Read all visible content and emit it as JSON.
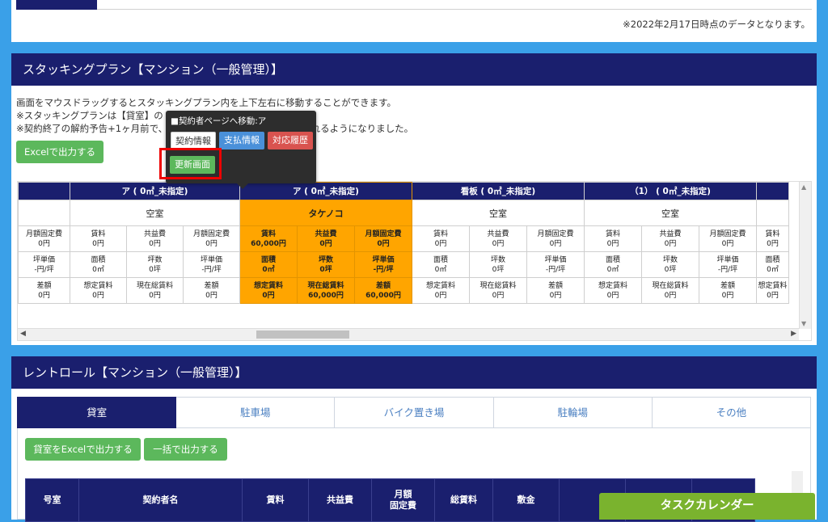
{
  "top": {
    "note": "※2022年2月17日時点のデータとなります。"
  },
  "stacking": {
    "title": "スタッキングプラン【マンション（一般管理）】",
    "desc1": "画面をマウスドラッグするとスタッキングプラン内を上下左右に移動することができます。",
    "desc2": "※スタッキングプランは【貸室】の",
    "desc3": "※契約終了の解約予告+1ヶ月前で、",
    "desc3b": "赤く表示されるようになりました。",
    "excel_button": "Excelで出力する",
    "units": [
      {
        "name": "",
        "tenant": "",
        "labels": [
          [
            "月額固定費",
            "0円"
          ],
          [
            "坪単価",
            "-円/坪"
          ],
          [
            "差額",
            "0円"
          ]
        ]
      },
      {
        "name": "ア ( 0㎡_未指定)",
        "tenant": "空室",
        "cells": [
          [
            [
              "賃料",
              "0円"
            ],
            [
              "共益費",
              "0円"
            ],
            [
              "月額固定費",
              "0円"
            ]
          ],
          [
            [
              "面積",
              "0㎡"
            ],
            [
              "坪数",
              "0坪"
            ],
            [
              "坪単価",
              "-円/坪"
            ]
          ],
          [
            [
              "想定賃料",
              "0円"
            ],
            [
              "現在総賃料",
              "0円"
            ],
            [
              "差額",
              "0円"
            ]
          ]
        ]
      },
      {
        "name": "ア ( 0㎡_未指定)",
        "tenant": "タケノコ",
        "highlight": true,
        "cells": [
          [
            [
              "賃料",
              "60,000円"
            ],
            [
              "共益費",
              "0円"
            ],
            [
              "月額固定費",
              "0円"
            ]
          ],
          [
            [
              "面積",
              "0㎡"
            ],
            [
              "坪数",
              "0坪"
            ],
            [
              "坪単価",
              "-円/坪"
            ]
          ],
          [
            [
              "想定賃料",
              "0円"
            ],
            [
              "現在総賃料",
              "60,000円"
            ],
            [
              "差額",
              "60,000円"
            ]
          ]
        ]
      },
      {
        "name": "看板 ( 0㎡_未指定)",
        "tenant": "空室",
        "cells": [
          [
            [
              "賃料",
              "0円"
            ],
            [
              "共益費",
              "0円"
            ],
            [
              "月額固定費",
              "0円"
            ]
          ],
          [
            [
              "面積",
              "0㎡"
            ],
            [
              "坪数",
              "0坪"
            ],
            [
              "坪単価",
              "-円/坪"
            ]
          ],
          [
            [
              "想定賃料",
              "0円"
            ],
            [
              "現在総賃料",
              "0円"
            ],
            [
              "差額",
              "0円"
            ]
          ]
        ]
      },
      {
        "name": "（1） ( 0㎡_未指定)",
        "tenant": "空室",
        "cells": [
          [
            [
              "賃料",
              "0円"
            ],
            [
              "共益費",
              "0円"
            ],
            [
              "月額固定費",
              "0円"
            ]
          ],
          [
            [
              "面積",
              "0㎡"
            ],
            [
              "坪数",
              "0坪"
            ],
            [
              "坪単価",
              "-円/坪"
            ]
          ],
          [
            [
              "想定賃料",
              "0円"
            ],
            [
              "現在総賃料",
              "0円"
            ],
            [
              "差額",
              "0円"
            ]
          ]
        ]
      },
      {
        "name": "",
        "tenant": "",
        "labels": [
          [
            "賃料",
            "0円"
          ],
          [
            "面積",
            "0㎡"
          ],
          [
            "想定賃料",
            "0円"
          ]
        ]
      }
    ]
  },
  "popup": {
    "title": "■契約者ページへ移動:ア",
    "contract_info": "契約情報",
    "payment_info": "支払情報",
    "history": "対応履歴",
    "update_screen": "更新画面"
  },
  "rentroll": {
    "title": "レントロール【マンション（一般管理）】",
    "tabs": [
      "貸室",
      "駐車場",
      "バイク置き場",
      "駐輪場",
      "その他"
    ],
    "excel_button": "貸室をExcelで出力する",
    "bulk_button": "一括で出力する",
    "columns": [
      "号室",
      "契約者名",
      "賃料",
      "共益費",
      "月額\n固定費",
      "総賃料",
      "敷金",
      "",
      "",
      ""
    ]
  },
  "task_calendar": "タスクカレンダー",
  "colors": {
    "navy": "#1a1f6e",
    "orange": "#ffa500",
    "green": "#5cb85c",
    "blue": "#3aa0e8",
    "lime": "#7ab32e"
  }
}
